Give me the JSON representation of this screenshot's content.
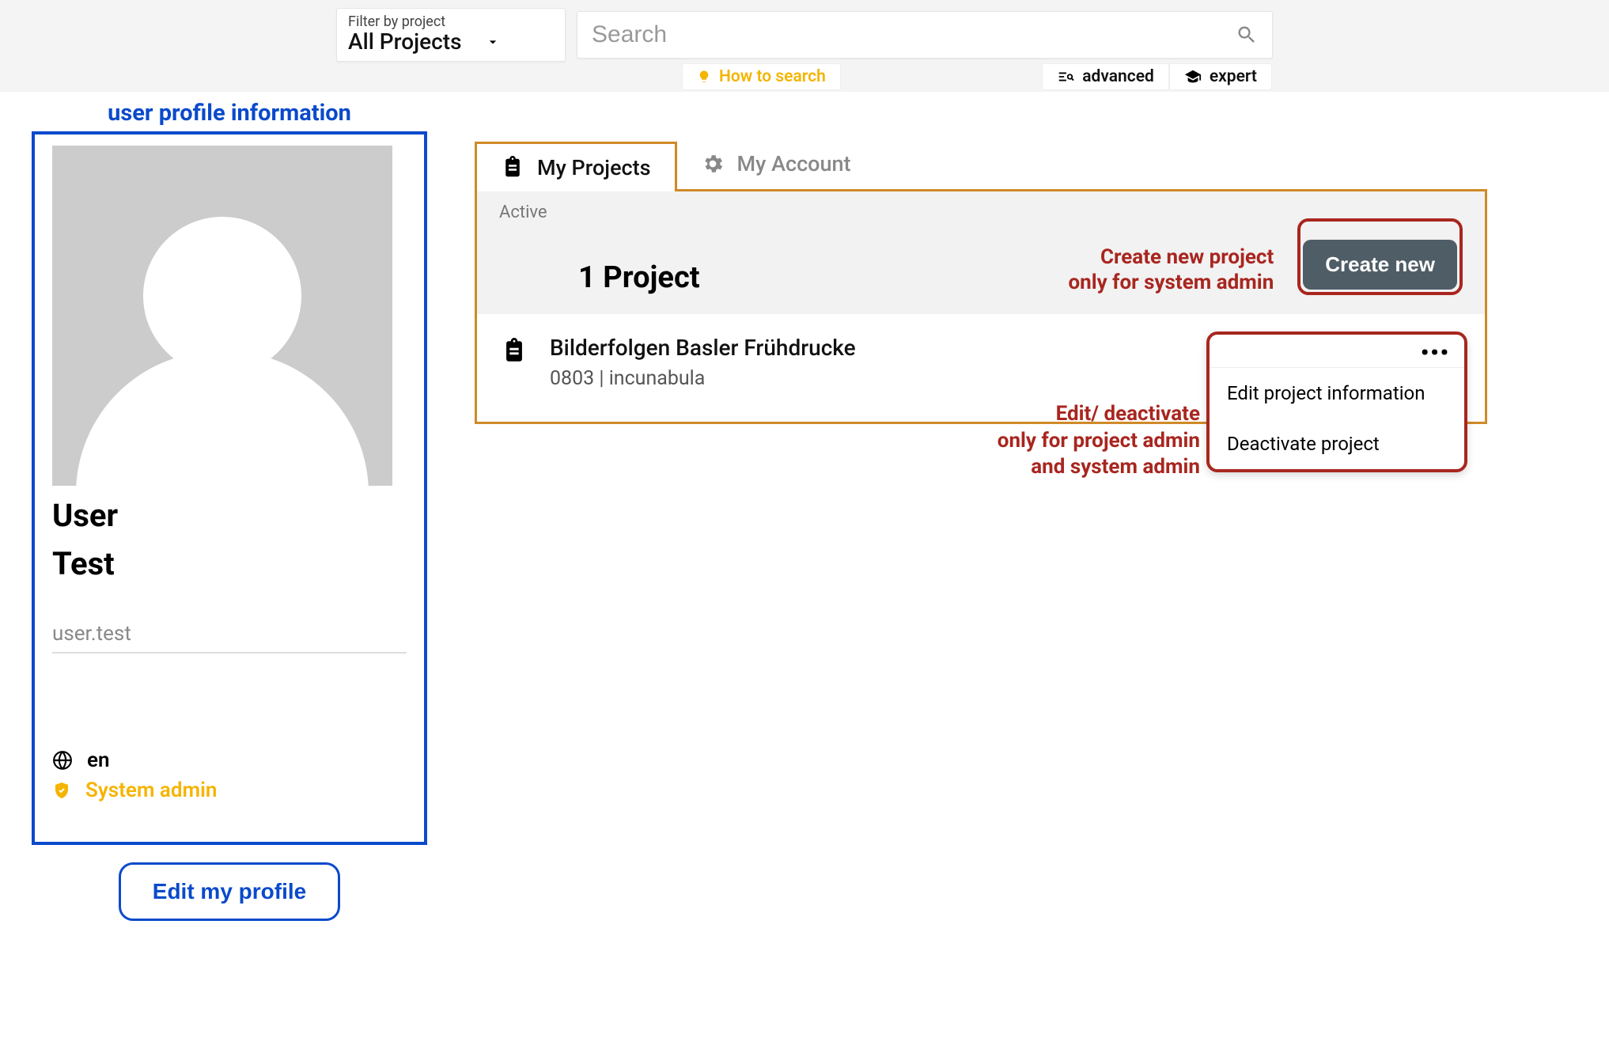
{
  "header": {
    "filter_label": "Filter by project",
    "filter_value": "All Projects",
    "search_placeholder": "Search",
    "hint": "How to search",
    "mode_advanced": "advanced",
    "mode_expert": "expert"
  },
  "profile": {
    "section_label": "user profile information",
    "first_name": "User",
    "last_name": "Test",
    "username": "user.test",
    "language": "en",
    "role": "System admin",
    "edit_button": "Edit my profile"
  },
  "tabs": {
    "projects": "My Projects",
    "account": "My Account"
  },
  "panel": {
    "active_label": "Active",
    "count_label": "1 Project",
    "create_note_l1": "Create new project",
    "create_note_l2": "only for system admin",
    "create_button": "Create new",
    "project": {
      "name": "Bilderfolgen Basler Frühdrucke",
      "meta": "0803 | incunabula"
    },
    "menu_note_l1": "Edit/ deactivate",
    "menu_note_l2": "only for project admin",
    "menu_note_l3": "and system admin",
    "menu": {
      "edit": "Edit project information",
      "deactivate": "Deactivate project"
    }
  }
}
